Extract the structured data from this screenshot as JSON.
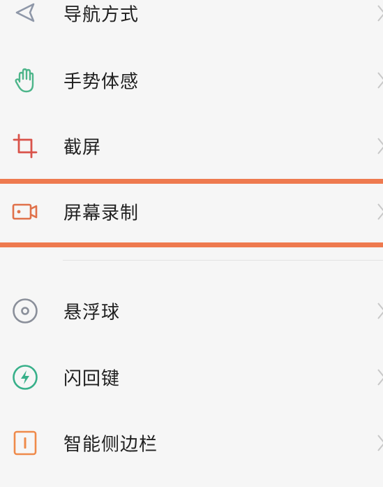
{
  "settings": {
    "items": [
      {
        "label": "导航方式",
        "icon": "navigation-arrow-icon"
      },
      {
        "label": "手势体感",
        "icon": "hand-gesture-icon"
      },
      {
        "label": "截屏",
        "icon": "crop-icon"
      },
      {
        "label": "屏幕录制",
        "icon": "video-camera-icon"
      },
      {
        "label": "悬浮球",
        "icon": "floating-ball-icon"
      },
      {
        "label": "闪回键",
        "icon": "lightning-icon"
      },
      {
        "label": "智能侧边栏",
        "icon": "sidebar-icon"
      }
    ]
  },
  "colors": {
    "highlight": "#ee7a4f",
    "navigation_icon": "#8e97a8",
    "gesture_icon": "#4db58a",
    "crop_icon": "#d9534a",
    "video_icon": "#e0714a",
    "floating_ball_icon": "#8a8f9a",
    "lightning_icon": "#38b08a",
    "sidebar_icon": "#ef8a4a"
  }
}
